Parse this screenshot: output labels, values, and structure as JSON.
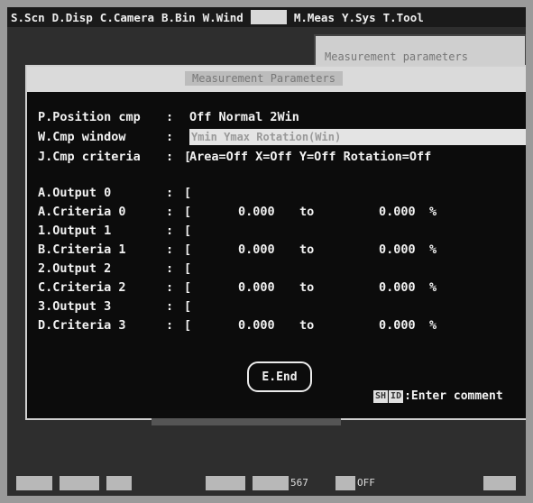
{
  "menubar": {
    "items": [
      "S.Scn",
      "D.Disp",
      "C.Camera",
      "B.Bin",
      "W.Wind",
      "M.Meas",
      "Y.Sys",
      "T.Tool"
    ]
  },
  "background_panel": {
    "title": "Measurement parameters"
  },
  "dialog": {
    "title": "Measurement Parameters",
    "position_cmp": {
      "label": "P.Position cmp",
      "value": "Off Normal 2Win"
    },
    "cmp_window": {
      "label": "W.Cmp window",
      "value": "Ymin  Ymax  Rotation(Win)"
    },
    "cmp_criteria": {
      "label": "J.Cmp criteria",
      "value": "Area=Off X=Off Y=Off Rotation=Off"
    },
    "outputs": [
      {
        "label": "A.Output 0",
        "criteria_label": "A.Criteria 0",
        "from": "0.000",
        "to_word": "to",
        "to": "0.000",
        "unit": "%"
      },
      {
        "label": "1.Output 1",
        "criteria_label": "B.Criteria 1",
        "from": "0.000",
        "to_word": "to",
        "to": "0.000",
        "unit": "%"
      },
      {
        "label": "2.Output 2",
        "criteria_label": "C.Criteria 2",
        "from": "0.000",
        "to_word": "to",
        "to": "0.000",
        "unit": "%"
      },
      {
        "label": "3.Output 3",
        "criteria_label": "D.Criteria 3",
        "from": "0.000",
        "to_word": "to",
        "to": "0.000",
        "unit": "%"
      }
    ],
    "end_button": "E.End",
    "hint": {
      "keys": [
        "SH",
        "ID"
      ],
      "text": ":Enter comment"
    }
  },
  "bottom_bar": {
    "readout": "567",
    "status": "OFF"
  },
  "colors": {
    "screen_bg": "#2e2e2e",
    "dialog_bg": "#0c0c0c",
    "text": "#f2f2f2",
    "highlight": "#e4e4e4"
  }
}
